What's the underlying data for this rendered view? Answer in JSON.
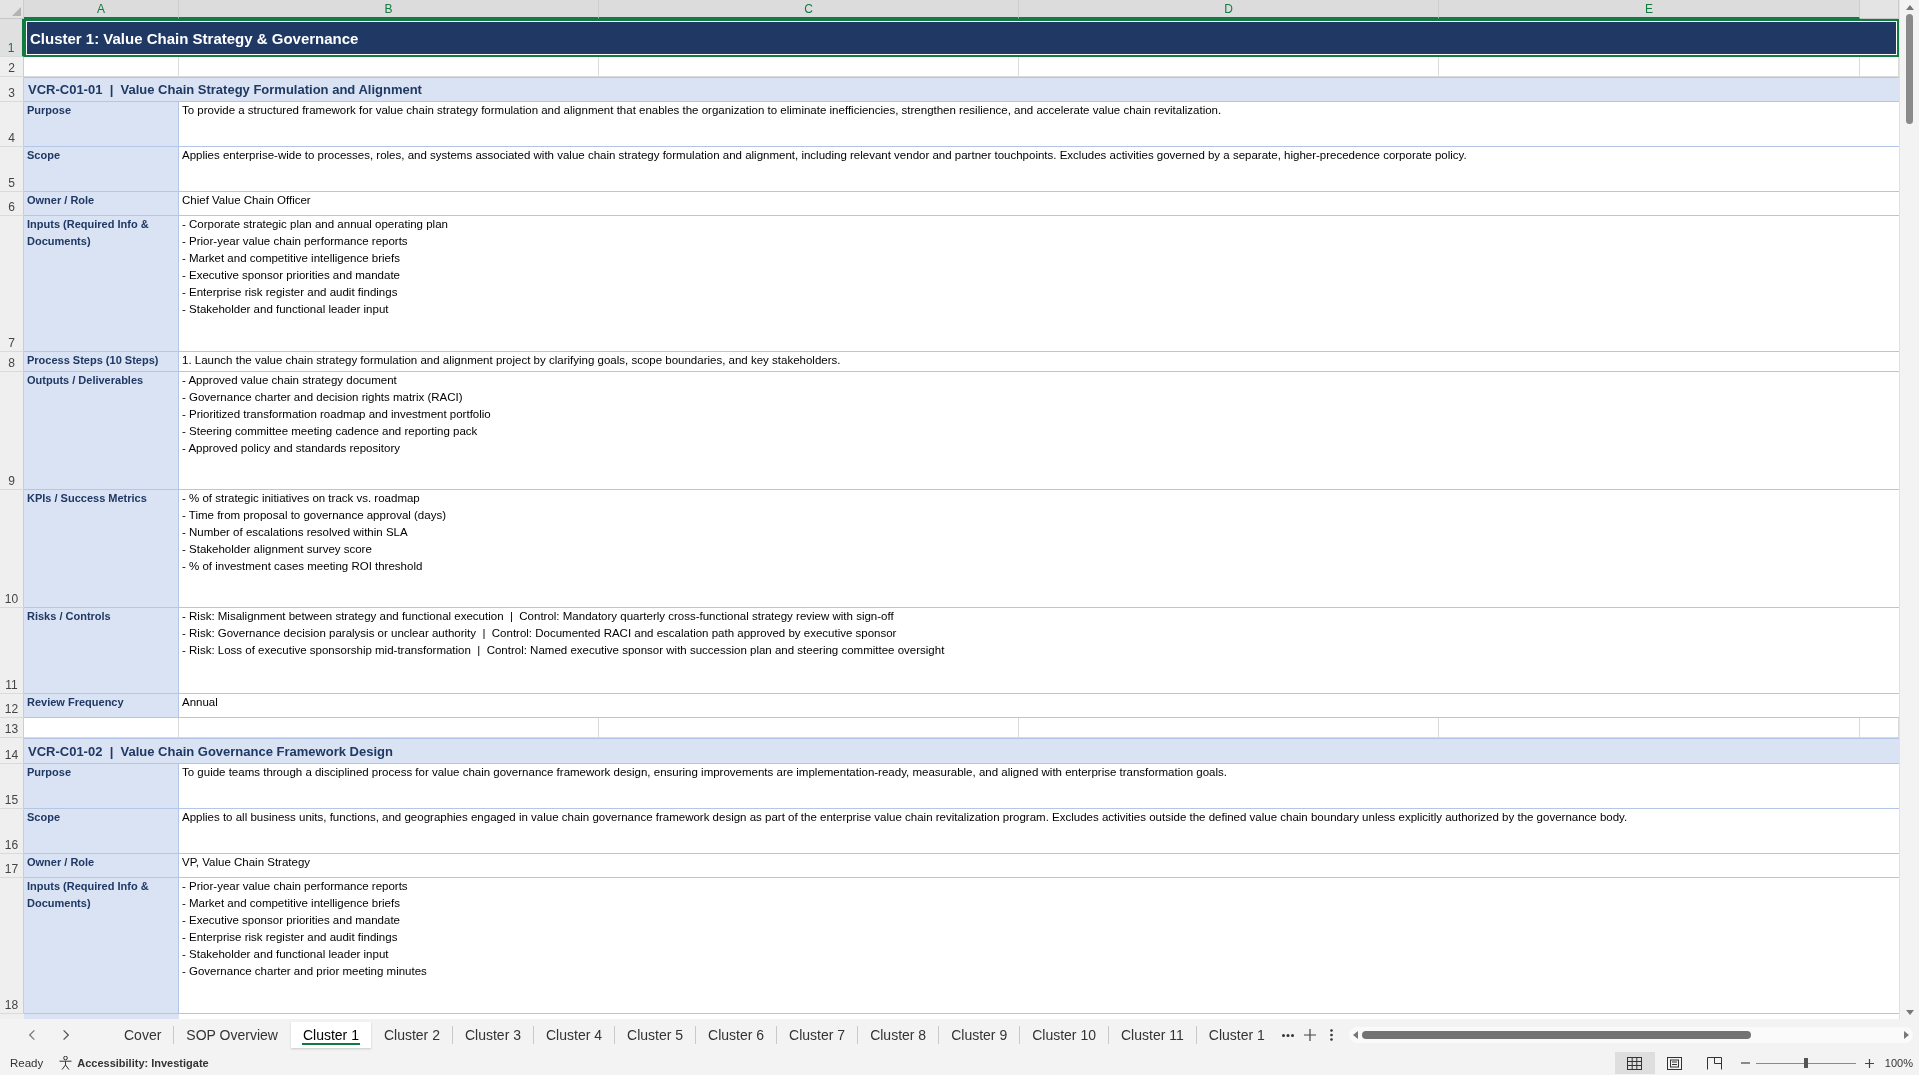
{
  "sheet": {
    "columns": [
      {
        "label": "A",
        "selected": true
      },
      {
        "label": "B",
        "selected": true
      },
      {
        "label": "C",
        "selected": true
      },
      {
        "label": "D",
        "selected": true
      },
      {
        "label": "E",
        "selected": true
      }
    ],
    "rows": [
      {
        "number": "1",
        "kind": "title",
        "selected": true,
        "text": "Cluster 1: Value Chain Strategy & Governance"
      },
      {
        "number": "2",
        "kind": "blank",
        "selected": false
      },
      {
        "number": "3",
        "kind": "section",
        "selected": false,
        "text": "VCR-C01-01  |  Value Chain Strategy Formulation and Alignment"
      },
      {
        "number": "4",
        "kind": "field",
        "selected": false,
        "label": "Purpose",
        "lines": [
          "To provide a structured framework for value chain strategy formulation and alignment that enables the organization to eliminate inefficiencies, strengthen resilience, and accelerate value chain revitalization."
        ]
      },
      {
        "number": "5",
        "kind": "field",
        "selected": false,
        "label": "Scope",
        "lines": [
          "Applies enterprise-wide to processes, roles, and systems associated with value chain strategy formulation and alignment, including relevant vendor and partner touchpoints. Excludes activities governed by a separate, higher-precedence corporate policy."
        ]
      },
      {
        "number": "6",
        "kind": "field",
        "selected": false,
        "label": "Owner / Role",
        "lines": [
          "Chief Value Chain Officer"
        ]
      },
      {
        "number": "7",
        "kind": "field",
        "selected": false,
        "label": "Inputs (Required Info & Documents)",
        "lines": [
          "- Corporate strategic plan and annual operating plan",
          "- Prior-year value chain performance reports",
          "- Market and competitive intelligence briefs",
          "- Executive sponsor priorities and mandate",
          "- Enterprise risk register and audit findings",
          "- Stakeholder and functional leader input"
        ]
      },
      {
        "number": "8",
        "kind": "field",
        "selected": false,
        "label": "Process Steps (10 Steps)",
        "lines": [
          "1. Launch the value chain strategy formulation and alignment project by clarifying goals, scope boundaries, and key stakeholders."
        ]
      },
      {
        "number": "9",
        "kind": "field",
        "selected": false,
        "label": "Outputs / Deliverables",
        "lines": [
          "- Approved value chain strategy document",
          "- Governance charter and decision rights matrix (RACI)",
          "- Prioritized transformation roadmap and investment portfolio",
          "- Steering committee meeting cadence and reporting pack",
          "- Approved policy and standards repository"
        ]
      },
      {
        "number": "10",
        "kind": "field",
        "selected": false,
        "label": "KPIs / Success Metrics",
        "lines": [
          "- % of strategic initiatives on track vs. roadmap",
          "- Time from proposal to governance approval (days)",
          "- Number of escalations resolved within SLA",
          "- Stakeholder alignment survey score",
          "- % of investment cases meeting ROI threshold"
        ]
      },
      {
        "number": "11",
        "kind": "field",
        "selected": false,
        "label": "Risks / Controls",
        "lines": [
          "- Risk: Misalignment between strategy and functional execution  |  Control: Mandatory quarterly cross-functional strategy review with sign-off",
          "- Risk: Governance decision paralysis or unclear authority  |  Control: Documented RACI and escalation path approved by executive sponsor",
          "- Risk: Loss of executive sponsorship mid-transformation  |  Control: Named executive sponsor with succession plan and steering committee oversight"
        ]
      },
      {
        "number": "12",
        "kind": "field",
        "selected": false,
        "label": "Review Frequency",
        "lines": [
          "Annual"
        ]
      },
      {
        "number": "13",
        "kind": "blank",
        "selected": false
      },
      {
        "number": "14",
        "kind": "section",
        "selected": false,
        "text": "VCR-C01-02  |  Value Chain Governance Framework Design"
      },
      {
        "number": "15",
        "kind": "field",
        "selected": false,
        "label": "Purpose",
        "lines": [
          "To guide teams through a disciplined process for value chain governance framework design, ensuring improvements are implementation-ready, measurable, and aligned with enterprise transformation goals."
        ]
      },
      {
        "number": "16",
        "kind": "field",
        "selected": false,
        "label": "Scope",
        "lines": [
          "Applies to all business units, functions, and geographies engaged in value chain governance framework design as part of the enterprise value chain revitalization program. Excludes activities outside the defined value chain boundary unless explicitly authorized by the governance body."
        ]
      },
      {
        "number": "17",
        "kind": "field",
        "selected": false,
        "label": "Owner / Role",
        "lines": [
          "VP, Value Chain Strategy"
        ]
      },
      {
        "number": "18",
        "kind": "field",
        "selected": false,
        "label": "Inputs (Required Info & Documents)",
        "lines": [
          "- Prior-year value chain performance reports",
          "- Market and competitive intelligence briefs",
          "- Executive sponsor priorities and mandate",
          "- Enterprise risk register and audit findings",
          "- Stakeholder and functional leader input",
          "- Governance charter and prior meeting minutes"
        ]
      }
    ]
  },
  "sheet_tabs": [
    {
      "label": "Cover",
      "selected": false
    },
    {
      "label": "SOP Overview",
      "selected": false
    },
    {
      "label": "Cluster 1",
      "selected": true
    },
    {
      "label": "Cluster 2",
      "selected": false
    },
    {
      "label": "Cluster 3",
      "selected": false
    },
    {
      "label": "Cluster 4",
      "selected": false
    },
    {
      "label": "Cluster 5",
      "selected": false
    },
    {
      "label": "Cluster 6",
      "selected": false
    },
    {
      "label": "Cluster 7",
      "selected": false
    },
    {
      "label": "Cluster 8",
      "selected": false
    },
    {
      "label": "Cluster 9",
      "selected": false
    },
    {
      "label": "Cluster 10",
      "selected": false
    },
    {
      "label": "Cluster 11",
      "selected": false
    },
    {
      "label": "Cluster 1",
      "selected": false
    }
  ],
  "status_bar": {
    "status": "Ready",
    "accessibility": "Accessibility: Investigate",
    "views": [
      {
        "kind": "normal",
        "selected": true
      },
      {
        "kind": "page_layout",
        "selected": false
      },
      {
        "kind": "page_break",
        "selected": false
      }
    ],
    "zoom": {
      "level": 0.5,
      "reading": "100%"
    }
  }
}
